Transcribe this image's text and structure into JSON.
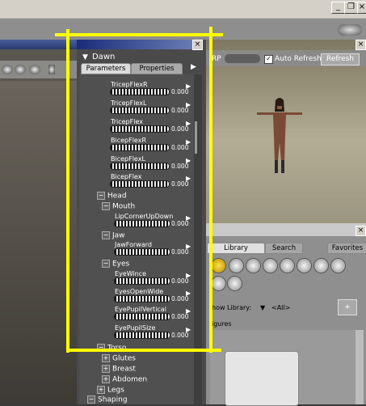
{
  "window": {
    "minimize_glyph": "_",
    "restore_glyph": "❐",
    "close_glyph": "×"
  },
  "parameters_panel": {
    "close_glyph": "×",
    "figure_name": "Dawn",
    "tabs": [
      "Parameters",
      "Properties"
    ],
    "dials": [
      {
        "label": "TricepFlexR",
        "value": "0.000"
      },
      {
        "label": "TricepFlexL",
        "value": "0.000"
      },
      {
        "label": "TricepFlex",
        "value": "0.000"
      },
      {
        "label": "BicepFlexR",
        "value": "0.000"
      },
      {
        "label": "BicepFlexL",
        "value": "0.000"
      },
      {
        "label": "BicepFlex",
        "value": "0.000"
      }
    ],
    "groups": {
      "head": "Head",
      "mouth": "Mouth",
      "jaw": "Jaw",
      "eyes": "Eyes",
      "torso": "Torso",
      "glutes": "Glutes",
      "breast": "Breast",
      "abdomen": "Abdomen",
      "legs": "Legs",
      "shaping": "Shaping"
    },
    "head_dials": [
      {
        "label": "LipCornerUpDown",
        "value": "0.000"
      },
      {
        "label": "JawForward",
        "value": "0.000"
      },
      {
        "label": "EyeWince",
        "value": "0.000"
      },
      {
        "label": "EyesOpenWide",
        "value": "0.000"
      },
      {
        "label": "EyePupilVertical",
        "value": "0.000"
      },
      {
        "label": "EyePupilSize",
        "value": "0.000"
      }
    ]
  },
  "preview_panel": {
    "close_glyph": "×",
    "rp_label": "RP",
    "auto_refresh_label": "Auto Refresh",
    "auto_refresh_checked": true,
    "refresh_label": "Refresh"
  },
  "library_panel": {
    "close_glyph": "×",
    "tabs": [
      "Library",
      "Search",
      "Favorites"
    ],
    "show_library_label": "how Library:",
    "show_library_value": "<All>",
    "dropdown_glyph": "▼",
    "figures_label": "igures",
    "add_glyph": "+",
    "icons": [
      "figures-icon",
      "poses-icon",
      "expressions-icon",
      "hair-icon",
      "hands-icon",
      "props-icon",
      "lights-icon",
      "cameras-icon",
      "materials-icon",
      "scenes-icon"
    ]
  },
  "colors": {
    "annotation": "#ffff00",
    "title_bar": "#1a2c7a"
  }
}
